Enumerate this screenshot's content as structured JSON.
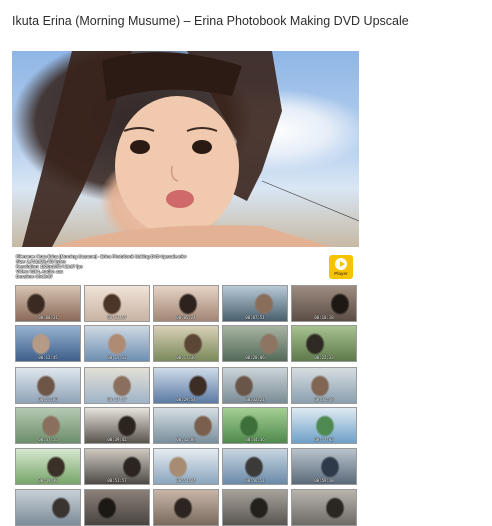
{
  "page": {
    "title": "Ikuta Erina (Morning Musume) – Erina Photobook Making DVD Upscale"
  },
  "hero": {
    "description_icon": "photo-image"
  },
  "info": {
    "lines": [
      "Filename: Ikuta Erina (Morning Musume) - Erina Photobook Making DVD Upscale.mkv",
      "Size: 2,718,825,452 bytes",
      "Resolution: 1920x1080 / 29.97 fps",
      "Video: h264, Audio: aac",
      "Duration: 00:39:57"
    ],
    "logo_label": "Player"
  },
  "thumbnails": {
    "rows": [
      [
        {
          "time": "00:00:31",
          "colors": [
            "#8a6a58",
            "#d7c2b2",
            "#3a2a22"
          ]
        },
        {
          "time": "00:02:57",
          "colors": [
            "#c9b3a2",
            "#f0e3d8",
            "#4b3428"
          ]
        },
        {
          "time": "00:05:24",
          "colors": [
            "#a28776",
            "#e6d3c5",
            "#2e221c"
          ]
        },
        {
          "time": "00:07:51",
          "colors": [
            "#4a5f6d",
            "#b7c9d5",
            "#8a6c5a"
          ]
        },
        {
          "time": "00:10:18",
          "colors": [
            "#5b4d46",
            "#9d8c80",
            "#1e1814"
          ]
        }
      ],
      [
        {
          "time": "00:12:45",
          "colors": [
            "#3e5f8a",
            "#97b2d1",
            "#b69a86"
          ]
        },
        {
          "time": "00:15:12",
          "colors": [
            "#6e8fb2",
            "#cfd9e3",
            "#b08b74"
          ]
        },
        {
          "time": "00:17:39",
          "colors": [
            "#7a8a5a",
            "#d8d0b8",
            "#5b4636"
          ]
        },
        {
          "time": "00:20:06",
          "colors": [
            "#536a59",
            "#a8b3a2",
            "#8e7463"
          ]
        },
        {
          "time": "00:22:33",
          "colors": [
            "#5e7a4a",
            "#a7c190",
            "#2f2a24"
          ]
        }
      ],
      [
        {
          "time": "00:25:00",
          "colors": [
            "#8fa3b8",
            "#dfe6ec",
            "#6e5647"
          ]
        },
        {
          "time": "00:27:27",
          "colors": [
            "#9fb4c8",
            "#e3e0d6",
            "#8a6f5c"
          ]
        },
        {
          "time": "00:29:54",
          "colors": [
            "#5b7aa3",
            "#cfdbe9",
            "#3c2d25"
          ]
        },
        {
          "time": "00:32:21",
          "colors": [
            "#7b8c96",
            "#cbd4d8",
            "#6a5648"
          ]
        },
        {
          "time": "00:34:48",
          "colors": [
            "#8aa0b0",
            "#d6dde0",
            "#7f6552"
          ]
        }
      ],
      [
        {
          "time": "00:37:15",
          "colors": [
            "#6c8e6a",
            "#b5c9b2",
            "#8a705c"
          ]
        },
        {
          "time": "00:39:42",
          "colors": [
            "#59544c",
            "#e6e2dc",
            "#2c241e"
          ]
        },
        {
          "time": "00:42:09",
          "colors": [
            "#788e9c",
            "#d6dee3",
            "#7a5f4c"
          ]
        },
        {
          "time": "00:44:36",
          "colors": [
            "#4f8a4c",
            "#a5cf93",
            "#3d6f3a"
          ]
        },
        {
          "time": "00:47:03",
          "colors": [
            "#6ea0c8",
            "#dfeaf2",
            "#4f8a52"
          ]
        }
      ],
      [
        {
          "time": "00:49:30",
          "colors": [
            "#77a56a",
            "#d6e7cf",
            "#3b3028"
          ]
        },
        {
          "time": "00:51:57",
          "colors": [
            "#4d4a46",
            "#cfc8c0",
            "#2b2420"
          ]
        },
        {
          "time": "00:54:24",
          "colors": [
            "#8aa5bd",
            "#e6ecf1",
            "#a78b72"
          ]
        },
        {
          "time": "00:56:51",
          "colors": [
            "#6a8aa8",
            "#c8d6e2",
            "#3c3a38"
          ]
        },
        {
          "time": "00:59:18",
          "colors": [
            "#5b6a7a",
            "#b9c3cc",
            "#2e3a4a"
          ]
        }
      ],
      [
        {
          "time": "",
          "colors": [
            "#7c8c9a",
            "#c8d0d6",
            "#3a3430"
          ]
        },
        {
          "time": "",
          "colors": [
            "#494440",
            "#8a8078",
            "#1c1814"
          ]
        },
        {
          "time": "",
          "colors": [
            "#7a6a5e",
            "#c7b6a8",
            "#2c2420"
          ]
        },
        {
          "time": "",
          "colors": [
            "#595550",
            "#a8a29c",
            "#24201c"
          ]
        },
        {
          "time": "",
          "colors": [
            "#6e6a66",
            "#b9b4ae",
            "#2a2622"
          ]
        }
      ]
    ]
  }
}
